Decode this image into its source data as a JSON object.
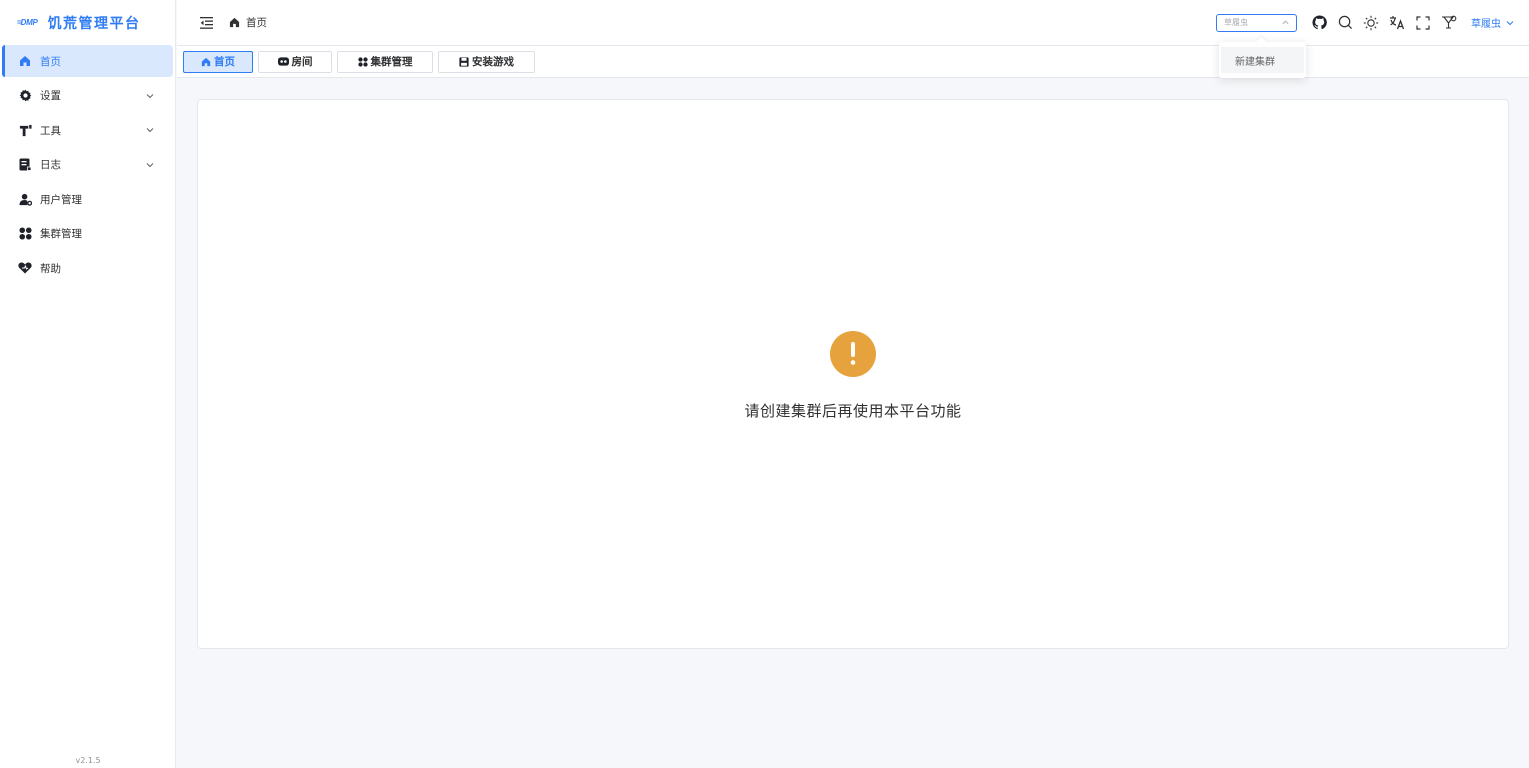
{
  "app": {
    "logo_mark": "DMP",
    "title": "饥荒管理平台",
    "version": "v2.1.5",
    "accent_color": "#2f7cf6"
  },
  "sidebar": {
    "items": [
      {
        "label": "首页",
        "icon": "home-icon",
        "active": true
      },
      {
        "label": "设置",
        "icon": "gear-icon",
        "expandable": true
      },
      {
        "label": "工具",
        "icon": "tools-icon",
        "expandable": true
      },
      {
        "label": "日志",
        "icon": "log-icon",
        "expandable": true
      },
      {
        "label": "用户管理",
        "icon": "user-manage-icon"
      },
      {
        "label": "集群管理",
        "icon": "cluster-icon"
      },
      {
        "label": "帮助",
        "icon": "help-icon"
      }
    ]
  },
  "header": {
    "breadcrumb": "首页",
    "cluster_select_value": "草履虫",
    "user_name": "草履虫",
    "icons": [
      "github-icon",
      "search-icon",
      "theme-sun-icon",
      "translate-icon",
      "fullscreen-icon",
      "theme-style-icon"
    ]
  },
  "tabs": [
    {
      "label": "首页",
      "icon": "home-icon",
      "active": true
    },
    {
      "label": "房间",
      "icon": "room-icon"
    },
    {
      "label": "集群管理",
      "icon": "cluster-icon"
    },
    {
      "label": "安装游戏",
      "icon": "install-icon"
    }
  ],
  "dropdown": {
    "items": [
      "新建集群"
    ]
  },
  "main": {
    "empty_message": "请创建集群后再使用本平台功能",
    "warning_color": "#e6a23c"
  }
}
